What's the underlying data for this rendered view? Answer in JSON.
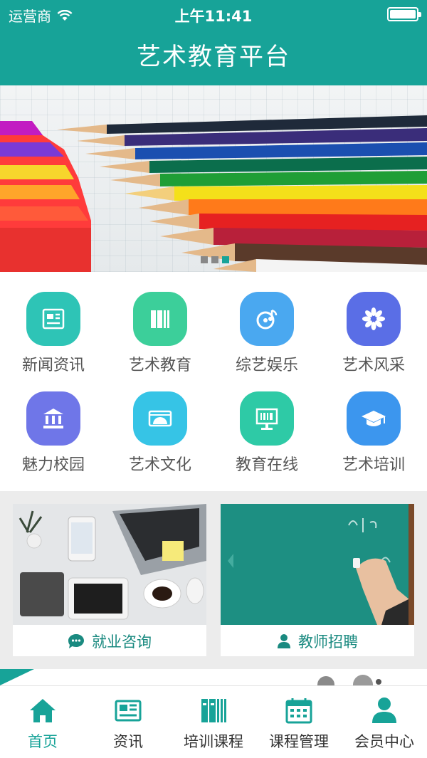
{
  "status": {
    "carrier": "运营商",
    "time": "上午11:41"
  },
  "header": {
    "title": "艺术教育平台"
  },
  "banner": {
    "slide_count": 3,
    "active_slide": 3
  },
  "grid": {
    "items": [
      {
        "label": "新闻资讯",
        "icon": "news-icon",
        "color": "#2ec4b6"
      },
      {
        "label": "艺术教育",
        "icon": "books-icon",
        "color": "#3ccf9a"
      },
      {
        "label": "综艺娱乐",
        "icon": "music-disc-icon",
        "color": "#4aa8f0"
      },
      {
        "label": "艺术风采",
        "icon": "flower-icon",
        "color": "#5a6ee6"
      },
      {
        "label": "魅力校园",
        "icon": "school-building-icon",
        "color": "#6f76e8"
      },
      {
        "label": "艺术文化",
        "icon": "culture-icon",
        "color": "#36c4e6"
      },
      {
        "label": "教育在线",
        "icon": "online-screen-icon",
        "color": "#2ecaa6"
      },
      {
        "label": "艺术培训",
        "icon": "graduation-cap-icon",
        "color": "#3c96ee"
      }
    ]
  },
  "cards": [
    {
      "label": "就业咨询",
      "icon": "chat-icon"
    },
    {
      "label": "教师招聘",
      "icon": "person-icon"
    }
  ],
  "tabbar": {
    "items": [
      {
        "label": "首页",
        "icon": "home-icon",
        "active": true
      },
      {
        "label": "资讯",
        "icon": "newspaper-icon",
        "active": false
      },
      {
        "label": "培训课程",
        "icon": "books-icon",
        "active": false
      },
      {
        "label": "课程管理",
        "icon": "calendar-icon",
        "active": false
      },
      {
        "label": "会员中心",
        "icon": "user-icon",
        "active": false
      }
    ]
  },
  "colors": {
    "accent": "#17a398",
    "card_text": "#1a8a80"
  }
}
